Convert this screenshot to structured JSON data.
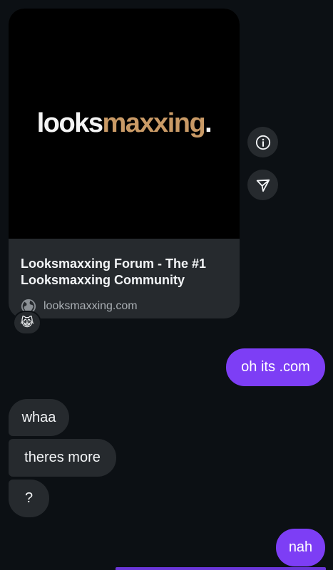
{
  "link_preview": {
    "logo_word": "looks",
    "logo_accent": "maxxing",
    "logo_dot": ".",
    "title": "Looksmaxxing Forum - The #1 Looksmaxxing Community",
    "domain": "looksmaxxing.com",
    "domain_icon": "globe-icon",
    "reaction": "😹"
  },
  "side_actions": {
    "info_icon": "info-icon",
    "share_icon": "send-icon"
  },
  "messages": [
    {
      "side": "outgoing",
      "text": "oh its .com"
    },
    {
      "side": "incoming",
      "text": "whaa"
    },
    {
      "side": "incoming",
      "text": "theres more"
    },
    {
      "side": "incoming",
      "text": "?"
    },
    {
      "side": "outgoing",
      "text": "nah"
    }
  ],
  "colors": {
    "background": "#0c1014",
    "incoming_bubble": "#262a2e",
    "outgoing_bubble": "#7d3ef5",
    "logo_accent": "#c99a66"
  }
}
